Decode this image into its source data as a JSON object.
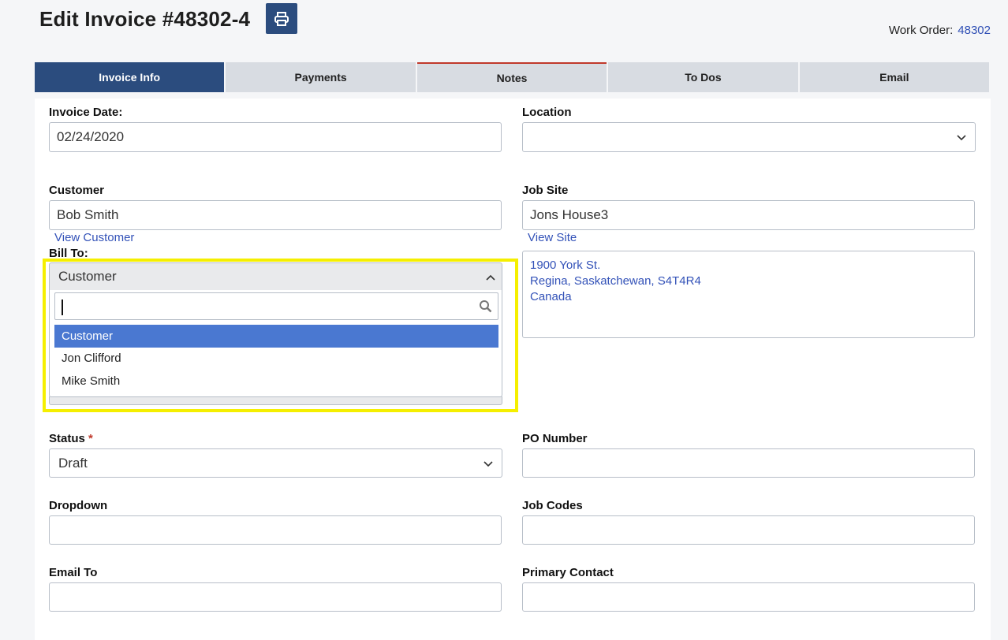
{
  "header": {
    "title": "Edit Invoice #48302-4",
    "print_icon": "printer-icon",
    "work_order_label": "Work Order:",
    "work_order_value": "48302"
  },
  "tabs": [
    {
      "label": "Invoice Info",
      "active": true
    },
    {
      "label": "Payments",
      "active": false
    },
    {
      "label": "Notes",
      "active": false
    },
    {
      "label": "To Dos",
      "active": false
    },
    {
      "label": "Email",
      "active": false
    }
  ],
  "form": {
    "invoice_date": {
      "label": "Invoice Date:",
      "value": "02/24/2020"
    },
    "location": {
      "label": "Location",
      "value": ""
    },
    "customer": {
      "label": "Customer",
      "value": "Bob Smith",
      "link": "View Customer"
    },
    "job_site": {
      "label": "Job Site",
      "value": "Jons House3",
      "link": "View Site"
    },
    "bill_to": {
      "label": "Bill To:",
      "value": "Customer",
      "search_value": "",
      "options": [
        "Customer",
        "Jon Clifford",
        "Mike Smith"
      ],
      "selected_index": 0
    },
    "address": [
      "1900 York St.",
      "Regina, Saskatchewan, S4T4R4",
      "Canada"
    ],
    "status": {
      "label": "Status",
      "required_mark": "*",
      "value": "Draft"
    },
    "po_number": {
      "label": "PO Number",
      "value": ""
    },
    "dropdown": {
      "label": "Dropdown",
      "value": ""
    },
    "job_codes": {
      "label": "Job Codes",
      "value": ""
    },
    "email_to": {
      "label": "Email To",
      "value": ""
    },
    "primary_contact": {
      "label": "Primary Contact",
      "value": ""
    }
  },
  "colors": {
    "primary": "#2b4c7e",
    "link": "#3352b8",
    "selected_option": "#4a78d1",
    "highlight": "#f5ef00"
  }
}
